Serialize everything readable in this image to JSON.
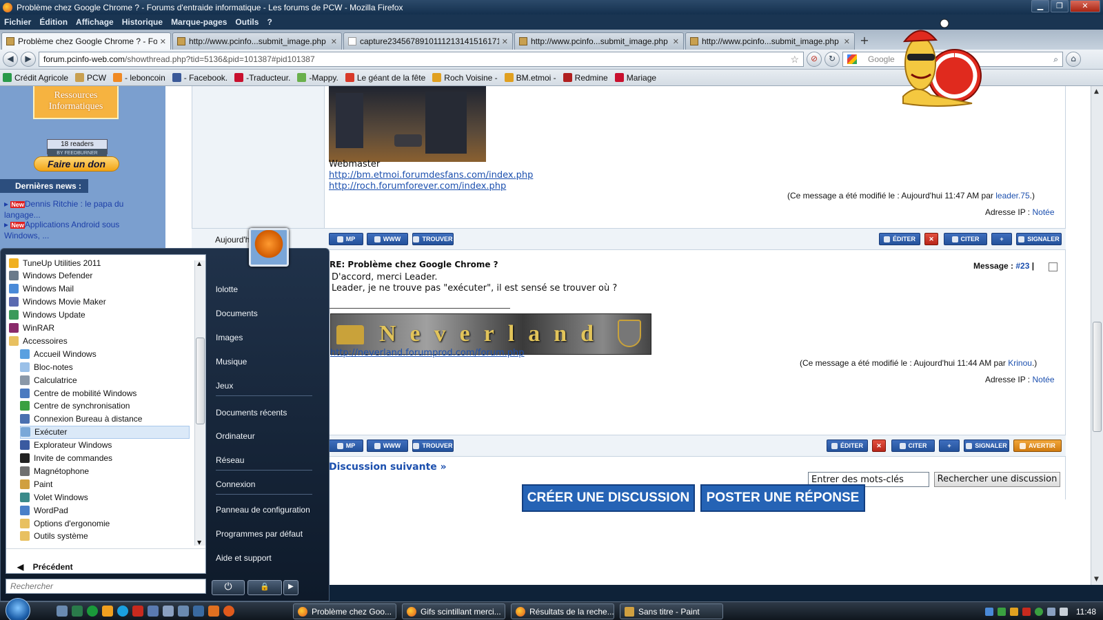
{
  "window": {
    "title": "Problème chez Google Chrome ? - Forums d'entraide informatique - Les forums de PCW - Mozilla Firefox",
    "minimize": "▁",
    "maximize": "❐",
    "close": "✕"
  },
  "menu": [
    "Fichier",
    "Édition",
    "Affichage",
    "Historique",
    "Marque-pages",
    "Outils",
    "?"
  ],
  "tabs": [
    {
      "label": "Problème chez Google Chrome ? - Fo...",
      "active": true
    },
    {
      "label": "http://www.pcinfo...submit_image.php"
    },
    {
      "label": "capture2345678910111213141516171​8..."
    },
    {
      "label": "http://www.pcinfo...submit_image.php"
    },
    {
      "label": "http://www.pcinfo...submit_image.php"
    }
  ],
  "navbar": {
    "url_domain": "forum.pcinfo-web.com",
    "url_path": "/showthread.php?tid=5136&pid=101387#pid101387",
    "search_placeholder": "Google"
  },
  "bookmarks": [
    {
      "label": "Crédit Agricole",
      "color": "#2a9a4a"
    },
    {
      "label": "PCW",
      "color": "#c8a050"
    },
    {
      "label": "- leboncoin",
      "color": "#f08a24"
    },
    {
      "label": "- Facebook.",
      "color": "#3b5998"
    },
    {
      "label": "-Traducteur.",
      "color": "#c8102e"
    },
    {
      "label": "-Mappy.",
      "color": "#6ab04c"
    },
    {
      "label": "Le géant de la fête",
      "color": "#d83a2a"
    },
    {
      "label": "Roch Voisine -",
      "color": "#e0a020"
    },
    {
      "label": "BM.etmoi -",
      "color": "#e0a020"
    },
    {
      "label": "Redmine",
      "color": "#b02020"
    },
    {
      "label": "Mariage",
      "color": "#c8102e"
    }
  ],
  "sidebar": {
    "logo": "Ressources Informatiques",
    "readers": "18 readers",
    "readers_sub": "BY FEEDBURNER",
    "donate": "Faire un don",
    "news_title": "Dernières news :",
    "news": [
      {
        "badge": "New",
        "text": "Dennis Ritchie : le papa du langage..."
      },
      {
        "badge": "New",
        "text": "Applications Android sous Windows, ..."
      }
    ]
  },
  "post1": {
    "signature": "Webmaster",
    "link1": "http://bm.etmoi.forumdesfans.com/index.php",
    "link2": "http://roch.forumforever.com/index.php",
    "modified_prefix": "(Ce message a été modifié le : Aujourd'hui 11:47 AM par",
    "modified_user": "leader.75",
    "modified_suffix": ".)",
    "ip_label": "Adresse IP :",
    "ip_value": "Notée",
    "date": "Aujourd'hui ... AM"
  },
  "post_buttons": {
    "mp": "MP",
    "www": "WWW",
    "trouver": "TROUVER",
    "editer": "ÉDITER",
    "citer": "CITER",
    "signaler": "SIGNALER",
    "avertir": "AVERTIR",
    "delete": "✕"
  },
  "post2": {
    "title": "RE: Problème chez Google Chrome ?",
    "msg_label": "Message :",
    "msg_num": "#23",
    "line1": "D'accord, merci Leader.",
    "line2": "Leader, je ne trouve pas \"exécuter\", il est sensé se trouver où ?",
    "banner_text": "Neverland",
    "link": "http://neverland.forumprod.com/forum.php",
    "modified_prefix": "(Ce message a été modifié le : Aujourd'hui 11:44 AM par",
    "modified_user": "Krinou",
    "modified_suffix": ".)",
    "ip_label": "Adresse IP :",
    "ip_value": "Notée"
  },
  "footer": {
    "next": "Discussion suivante »",
    "keywords_value": "Entrer des mots-clés",
    "search_button": "Rechercher une discussion",
    "create": "CRÉER UNE DISCUSSION",
    "reply": "POSTER UNE RÉPONSE"
  },
  "startmenu": {
    "programs": [
      {
        "label": "TuneUp Utilities 2011",
        "color": "#f0b020",
        "indent": 0
      },
      {
        "label": "Windows Defender",
        "color": "#6a7a8a",
        "indent": 0
      },
      {
        "label": "Windows Mail",
        "color": "#4a8ad8",
        "indent": 0
      },
      {
        "label": "Windows Movie Maker",
        "color": "#5a6ab0",
        "indent": 0
      },
      {
        "label": "Windows Update",
        "color": "#3a9a5a",
        "indent": 0
      },
      {
        "label": "WinRAR",
        "color": "#8a2a6a",
        "indent": 0
      },
      {
        "label": "Accessoires",
        "color": "#e8c060",
        "indent": 0
      },
      {
        "label": "Accueil Windows",
        "color": "#5aa0e0",
        "indent": 1
      },
      {
        "label": "Bloc-notes",
        "color": "#9ac0e8",
        "indent": 1
      },
      {
        "label": "Calculatrice",
        "color": "#8a98a8",
        "indent": 1
      },
      {
        "label": "Centre de mobilité Windows",
        "color": "#4a7ac0",
        "indent": 1
      },
      {
        "label": "Centre de synchronisation",
        "color": "#3aa040",
        "indent": 1
      },
      {
        "label": "Connexion Bureau à distance",
        "color": "#4a70b0",
        "indent": 1
      },
      {
        "label": "Exécuter",
        "color": "#7aa8d8",
        "indent": 1,
        "selected": true
      },
      {
        "label": "Explorateur Windows",
        "color": "#3a5aa0",
        "indent": 1
      },
      {
        "label": "Invite de commandes",
        "color": "#222222",
        "indent": 1
      },
      {
        "label": "Magnétophone",
        "color": "#707070",
        "indent": 1
      },
      {
        "label": "Paint",
        "color": "#d0a040",
        "indent": 1
      },
      {
        "label": "Volet Windows",
        "color": "#3a8a8a",
        "indent": 1
      },
      {
        "label": "WordPad",
        "color": "#4a80c8",
        "indent": 1
      },
      {
        "label": "Options d'ergonomie",
        "color": "#e8c060",
        "indent": 1
      },
      {
        "label": "Outils système",
        "color": "#e8c060",
        "indent": 1
      }
    ],
    "back": "Précédent",
    "search_placeholder": "Rechercher",
    "right_items": [
      "lolotte",
      "Documents",
      "Images",
      "Musique",
      "Jeux",
      "Documents récents",
      "Ordinateur",
      "Réseau",
      "Connexion",
      "Panneau de configuration",
      "Programmes par défaut",
      "Aide et support"
    ],
    "power_glyph": "⏻",
    "lock_glyph": "🔒",
    "arrow_glyph": "▶"
  },
  "taskbar": {
    "tasks": [
      "Problème chez Goo...",
      "Gifs scintillant merci...",
      "Résultats de la reche...",
      "Sans titre - Paint"
    ],
    "clock": "11:48"
  }
}
